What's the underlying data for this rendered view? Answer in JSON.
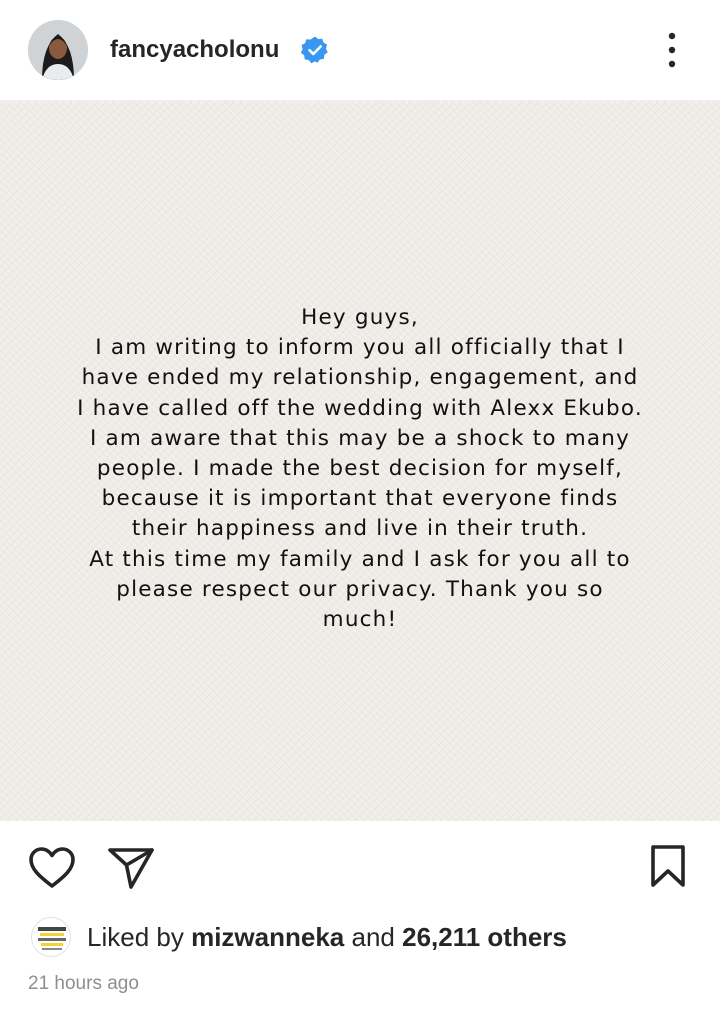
{
  "header": {
    "username": "fancyacholonu",
    "verified": true,
    "more_icon": "more-vertical-icon"
  },
  "post": {
    "lines": [
      "Hey guys,",
      "I am writing to inform you all officially that I",
      "have ended my relationship, engagement, and",
      "I have called off the wedding with Alexx Ekubo.",
      "I am aware that this may be a shock to many",
      "people. I made the best decision for myself,",
      "because it is important that everyone finds",
      "their happiness and live in their truth.",
      "At this time my family and I ask for you all to",
      "please respect our privacy. Thank you so",
      "much!"
    ],
    "background": "#efece7"
  },
  "actions": {
    "like_icon": "heart-icon",
    "share_icon": "send-icon",
    "save_icon": "bookmark-icon"
  },
  "likes": {
    "prefix": "Liked by",
    "user": "mizwanneka",
    "connector": "and",
    "others": "26,211 others"
  },
  "timestamp": "21 hours ago",
  "colors": {
    "verified_blue": "#3897f0",
    "text": "#262626",
    "muted": "#8e8e8e"
  }
}
